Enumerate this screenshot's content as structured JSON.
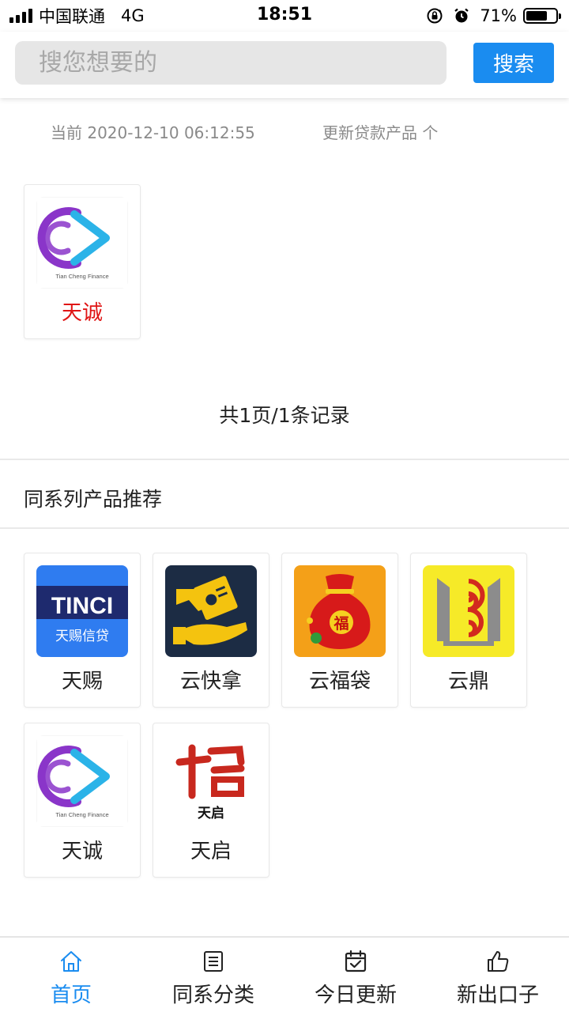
{
  "status_bar": {
    "carrier": "中国联通",
    "network": "4G",
    "time": "18:51",
    "battery": "71%",
    "battery_level": 0.71
  },
  "search": {
    "placeholder": "搜您想要的",
    "button_label": "搜索",
    "accent_color": "#1a8cf0"
  },
  "info": {
    "current": "当前 2020-12-10 06:12:55",
    "update": "更新贷款产品 个"
  },
  "results": {
    "items": [
      {
        "name": "天诚",
        "logo": "tiancheng-logo",
        "logo_text": "Tian Cheng Finance",
        "name_color": "#e01515"
      }
    ],
    "pagination": "共1页/1条记录"
  },
  "recommend": {
    "title": "同系列产品推荐",
    "items": [
      {
        "name": "天赐",
        "logo": "tinci-logo",
        "logo_text": "TINCI",
        "logo_subtext": "天赐信贷"
      },
      {
        "name": "云快拿",
        "logo": "yunkuaina-logo"
      },
      {
        "name": "云福袋",
        "logo": "yunfudai-logo",
        "logo_text": "福"
      },
      {
        "name": "云鼎",
        "logo": "yunding-logo"
      },
      {
        "name": "天诚",
        "logo": "tiancheng-logo",
        "logo_text": "Tian Cheng Finance"
      },
      {
        "name": "天启",
        "logo": "tianqi-logo",
        "logo_text": "天启"
      }
    ]
  },
  "bottom_nav": {
    "items": [
      {
        "label": "首页",
        "icon": "home-icon",
        "active": true
      },
      {
        "label": "同系分类",
        "icon": "list-icon",
        "active": false
      },
      {
        "label": "今日更新",
        "icon": "calendar-check-icon",
        "active": false
      },
      {
        "label": "新出口子",
        "icon": "thumbs-up-icon",
        "active": false
      }
    ]
  }
}
